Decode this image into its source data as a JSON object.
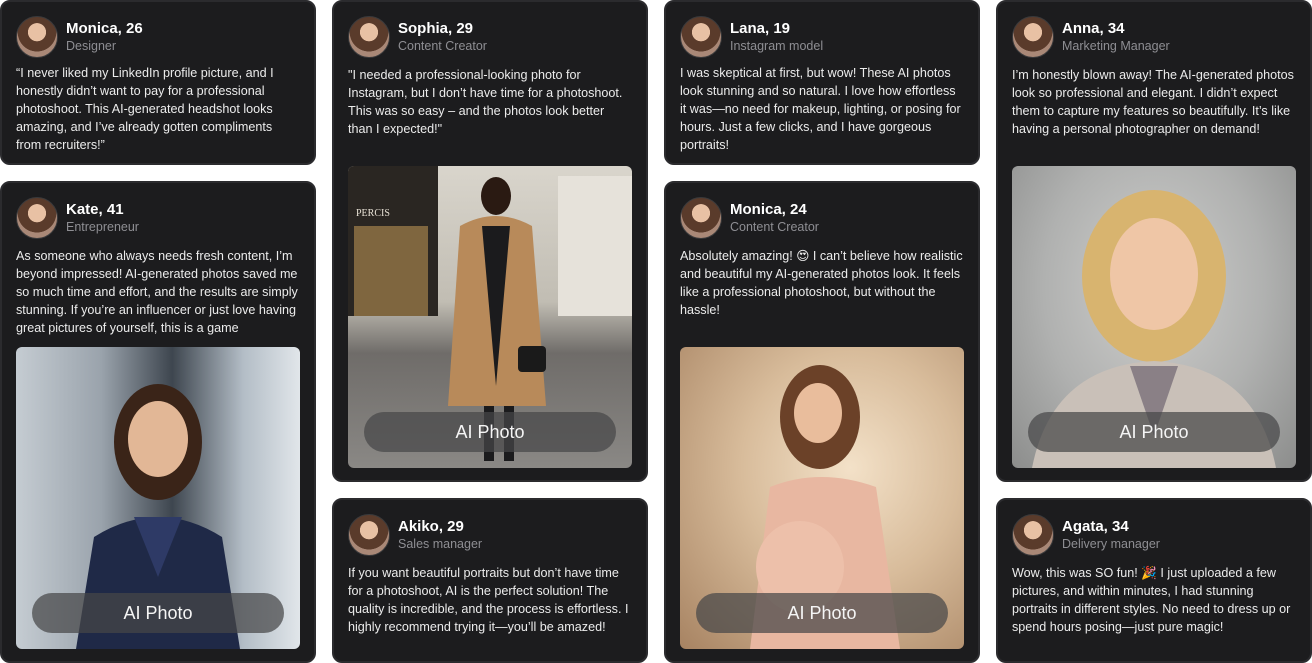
{
  "cards": [
    {
      "name": "Monica, 26",
      "role": "Designer",
      "text": "“I never liked my LinkedIn profile picture, and I honestly didn’t want to pay for a professional photoshoot. This AI-generated headshot looks amazing, and I’ve already gotten compliments from recruiters!”"
    },
    {
      "name": "Kate, 41",
      "role": "Entrepreneur",
      "text": "As someone who always needs fresh content, I’m beyond impressed! AI-generated photos saved me so much time and effort, and the results are simply stunning. If you’re an influencer or just love having great pictures of yourself, this is a game",
      "photo_label": "AI Photo"
    },
    {
      "name": "Sophia, 29",
      "role": "Content Creator",
      "text": "\"I needed a professional-looking photo for Instagram, but I don’t have time for a photoshoot. This was so easy – and the photos look better than I expected!\"",
      "photo_label": "AI Photo"
    },
    {
      "name": "Akiko, 29",
      "role": "Sales manager",
      "text": "If you want beautiful portraits but don’t have time for a photoshoot, AI is the perfect solution! The quality is incredible, and the process is effortless. I highly recommend trying it—you’ll be amazed!"
    },
    {
      "name": "Lana, 19",
      "role": "Instagram model",
      "text": "I was skeptical at first, but wow! These AI photos look stunning and so natural. I love how effortless it was—no need for makeup, lighting, or posing for hours. Just a few clicks, and I have gorgeous portraits!"
    },
    {
      "name": "Monica, 24",
      "role": "Content Creator",
      "text": "Absolutely amazing! 😍 I can’t believe how realistic and beautiful my AI-generated photos look. It feels like a professional photoshoot, but without the hassle!",
      "photo_label": "AI Photo"
    },
    {
      "name": "Anna, 34",
      "role": "Marketing Manager",
      "text": "I’m honestly blown away! The AI-generated photos look so professional and elegant. I didn’t expect them to capture my features so beautifully. It’s like having a personal photographer on demand!",
      "photo_label": "AI Photo"
    },
    {
      "name": "Agata, 34",
      "role": "Delivery manager",
      "text": "Wow, this was SO fun! 🎉 I just uploaded a few pictures, and within minutes, I had stunning portraits in different styles. No need to dress up or spend hours posing—just pure magic!"
    }
  ],
  "street_sign": "PERCIS",
  "colors": {
    "page_bg": "#ffffff",
    "card_bg": "#1c1c1e",
    "card_border": "#2b2b2e",
    "role_text": "#8e8e93"
  }
}
